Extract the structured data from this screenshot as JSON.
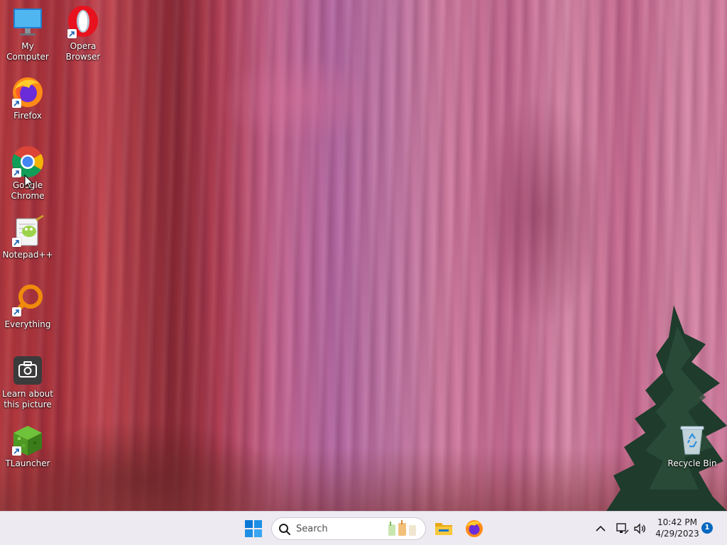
{
  "desktop": {
    "icons": [
      {
        "id": "my-computer",
        "label": "My Computer"
      },
      {
        "id": "opera",
        "label": "Opera\nBrowser"
      },
      {
        "id": "firefox",
        "label": "Firefox"
      },
      {
        "id": "chrome",
        "label": "Google\nChrome"
      },
      {
        "id": "notepadpp",
        "label": "Notepad++"
      },
      {
        "id": "everything",
        "label": "Everything"
      },
      {
        "id": "learn-picture",
        "label": "Learn about\nthis picture"
      },
      {
        "id": "tlauncher",
        "label": "TLauncher"
      },
      {
        "id": "recycle-bin",
        "label": "Recycle Bin"
      }
    ]
  },
  "taskbar": {
    "search": {
      "placeholder": "Search"
    },
    "clock": {
      "time": "10:42 PM",
      "date": "4/29/2023"
    },
    "notifications": {
      "count": "1"
    }
  },
  "colors": {
    "taskbar_bg": "#eeeaf1",
    "accent": "#0067c0",
    "start_blue": "#0a78d6"
  }
}
